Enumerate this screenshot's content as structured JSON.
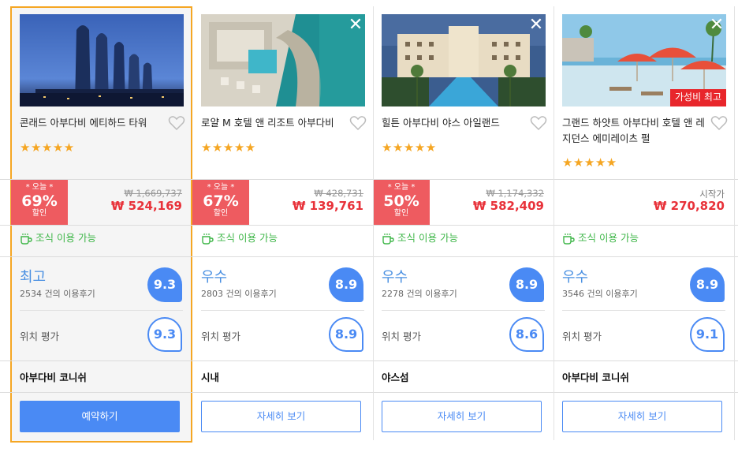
{
  "hotels": [
    {
      "name": "콘래드 아부다비 에티하드 타워",
      "stars": "★★★★★",
      "deal": {
        "today": "* 오늘 *",
        "percent": "69%",
        "off": "할인"
      },
      "price_original": "₩ 1,669,737",
      "price": "₩ 524,169",
      "breakfast": "조식 이용 가능",
      "rating_word": "최고",
      "review_count": "2534 건의 이용후기",
      "score": "9.3",
      "location_label": "위치 평가",
      "location_score": "9.3",
      "district": "아부다비 코니쉬",
      "button": "예약하기",
      "selected": true
    },
    {
      "name": "로얄 M 호텔 앤 리조트 아부다비",
      "stars": "★★★★★",
      "deal": {
        "today": "* 오늘 *",
        "percent": "67%",
        "off": "할인"
      },
      "price_original": "₩ 428,731",
      "price": "₩ 139,761",
      "breakfast": "조식 이용 가능",
      "rating_word": "우수",
      "review_count": "2803 건의 이용후기",
      "score": "8.9",
      "location_label": "위치 평가",
      "location_score": "8.9",
      "district": "시내",
      "button": "자세히 보기",
      "close": "✕"
    },
    {
      "name": "힐튼 아부다비 야스 아일랜드",
      "stars": "★★★★★",
      "deal": {
        "today": "* 오늘 *",
        "percent": "50%",
        "off": "할인"
      },
      "price_original": "₩ 1,174,332",
      "price": "₩ 582,409",
      "breakfast": "조식 이용 가능",
      "rating_word": "우수",
      "review_count": "2278 건의 이용후기",
      "score": "8.9",
      "location_label": "위치 평가",
      "location_score": "8.6",
      "district": "야스섬",
      "button": "자세히 보기",
      "close": "✕"
    },
    {
      "name": "그랜드 하얏트 아부다비 호텔 앤 레지던스 에미레이츠 펄",
      "stars": "★★★★★",
      "badge": "가성비 최고",
      "price_from": "시작가",
      "price": "₩ 270,820",
      "breakfast": "조식 이용 가능",
      "rating_word": "우수",
      "review_count": "3546 건의 이용후기",
      "score": "8.9",
      "location_label": "위치 평가",
      "location_score": "9.1",
      "district": "아부다비 코니쉬",
      "button": "자세히 보기",
      "close": "✕"
    }
  ],
  "colors": {
    "accent_blue": "#4a8af4",
    "deal_red": "#ee5b60",
    "price_red": "#e8323a",
    "breakfast_green": "#3eb648",
    "star_orange": "#f5a623",
    "selected_border": "#f5a623"
  },
  "icons": {
    "favorite": "heart-outline-icon",
    "close": "close-icon",
    "breakfast": "coffee-cup-icon",
    "star": "star-icon"
  }
}
